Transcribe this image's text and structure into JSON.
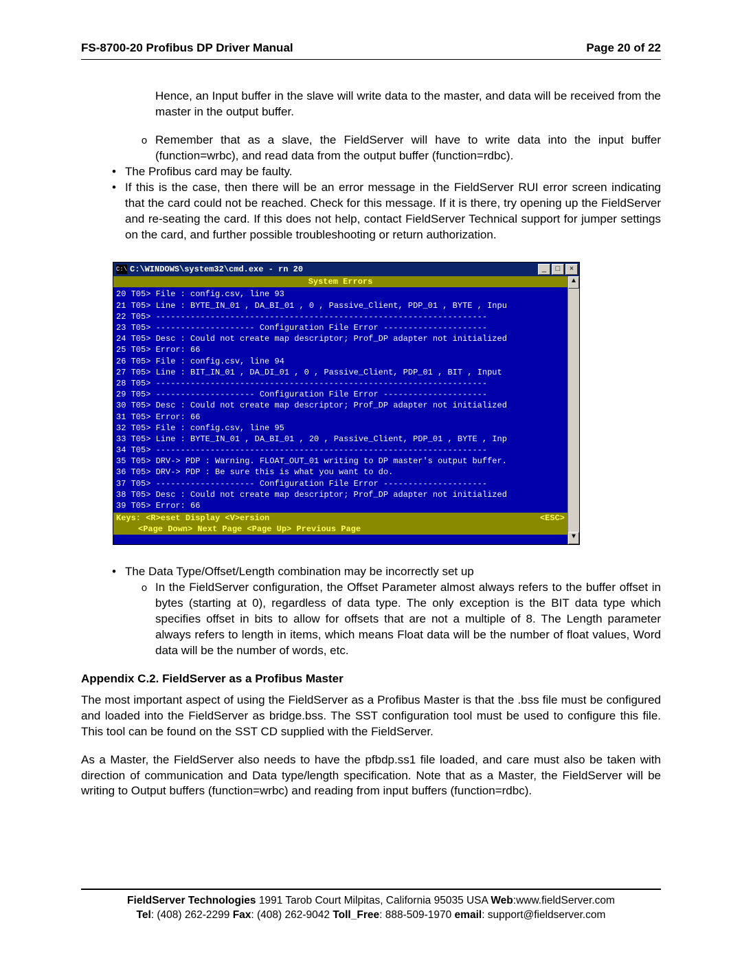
{
  "header": {
    "title": "FS-8700-20 Profibus DP Driver Manual",
    "page": "Page 20 of 22"
  },
  "intro": {
    "p1": "Hence, an Input buffer in the slave will write data to the master, and data will be received from the master in the output buffer.",
    "sub1": "Remember that as a slave, the FieldServer will have to write data into the input buffer (function=wrbc), and read data from the output buffer (function=rdbc).",
    "b2": "The Profibus card may be faulty.",
    "b3": "If this is the case, then there will be an error message in the FieldServer RUI error screen indicating that the card could not be reached. Check for this message. If it is there, try opening up the FieldServer and re-seating the card. If this does not help, contact FieldServer Technical support for jumper settings on the card, and further possible troubleshooting or return authorization."
  },
  "cmd": {
    "icon_text": "C:\\",
    "title": "C:\\WINDOWS\\system32\\cmd.exe - rn 20",
    "min": "_",
    "max": "□",
    "close": "×",
    "sys_header": "System Errors",
    "lines": [
      "20 T05> File : config.csv, line 93",
      "21 T05> Line : BYTE_IN_01 , DA_BI_01 , 0 , Passive_Client, PDP_01 , BYTE , Inpu",
      "22 T05> -------------------------------------------------------------------",
      "23 T05> -------------------- Configuration File Error ---------------------",
      "24 T05> Desc : Could not create map descriptor; Prof_DP adapter not initialized",
      "25 T05> Error: 66",
      "26 T05> File : config.csv, line 94",
      "27 T05> Line : BIT_IN_01 , DA_DI_01 , 0 , Passive_Client, PDP_01 , BIT , Input",
      "28 T05> -------------------------------------------------------------------",
      "29 T05> -------------------- Configuration File Error ---------------------",
      "30 T05> Desc : Could not create map descriptor; Prof_DP adapter not initialized",
      "31 T05> Error: 66",
      "32 T05> File : config.csv, line 95",
      "33 T05> Line : BYTE_IN_01 , DA_BI_01 , 20 , Passive_Client, PDP_01 , BYTE , Inp",
      "34 T05> -------------------------------------------------------------------",
      "35 T05> DRV-> PDP : Warning. FLOAT_OUT_01 writing to DP master's output buffer.",
      "36 T05> DRV-> PDP : Be sure this is what you want to do.",
      "37 T05> -------------------- Configuration File Error ---------------------",
      "38 T05> Desc : Could not create map descriptor; Prof_DP adapter not initialized",
      "39 T05> Error: 66"
    ],
    "foot1_left": "Keys: <R>eset  Display <V>ersion",
    "foot1_right": "<ESC>",
    "foot2": "<Page Down> Next Page  <Page Up> Previous Page",
    "scroll_up": "▲",
    "scroll_down": "▼"
  },
  "after": {
    "b1": "The Data Type/Offset/Length combination may be incorrectly set up",
    "sub1": "In the FieldServer configuration, the Offset Parameter almost always refers to the buffer offset in bytes (starting at 0), regardless of data type. The only exception is the BIT data type which specifies offset in bits to allow for offsets that are not a multiple of 8. The Length parameter always refers to length in items, which means Float data will be the number of float values, Word data will be the number of words, etc."
  },
  "appendix": {
    "title": "Appendix C.2.   FieldServer as a Profibus Master",
    "p1": "The most important aspect of using the FieldServer as a Profibus Master is that the .bss file must be configured and loaded into the FieldServer as bridge.bss. The SST configuration tool must be used to configure this file. This tool can be found on the SST CD supplied with the FieldServer.",
    "p2": "As a Master, the FieldServer also needs to have the pfbdp.ss1 file loaded, and care must also be taken with direction of communication and Data type/length specification. Note that as a Master, the FieldServer will be writing to Output buffers (function=wrbc) and reading from input buffers (function=rdbc)."
  },
  "footer": {
    "company_bold": "FieldServer Technologies",
    "addr": " 1991 Tarob Court Milpitas, California 95035 USA  ",
    "web_lbl": "Web",
    "web_val": ":www.fieldServer.com",
    "tel_lbl": "Tel",
    "tel_val": ": (408) 262-2299  ",
    "fax_lbl": "Fax",
    "fax_val": ": (408) 262-9042  ",
    "toll_lbl": "Toll_Free",
    "toll_val": ": 888-509-1970  ",
    "email_lbl": "email",
    "email_val": ": support@fieldserver.com"
  }
}
